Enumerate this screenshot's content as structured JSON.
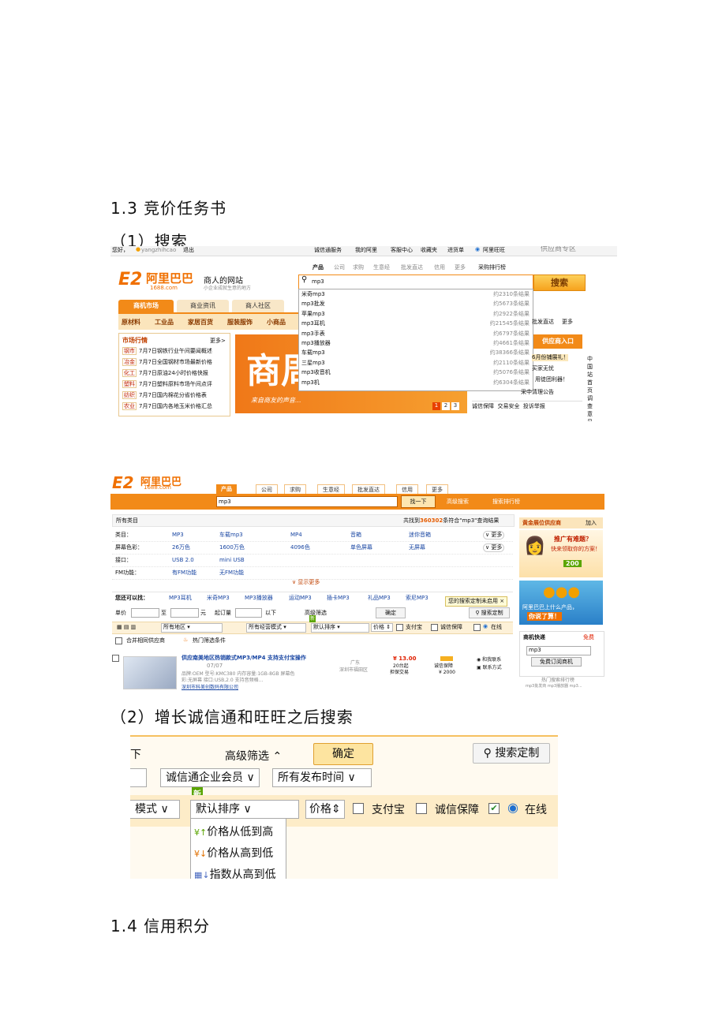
{
  "headings": {
    "h13": "1.3 竞价任务书",
    "search": "（1）搜索",
    "after": "（2）增长诚信通和旺旺之后搜索",
    "h14": "1.4 信用积分"
  },
  "shot1": {
    "topbar_user": "您好，",
    "username": "yangzhihcao",
    "logout": "退出",
    "topbar_links": [
      "诚信通服务",
      "我的阿里",
      "客服中心",
      "收藏夹",
      "进货单",
      "阿里旺旺",
      "供应商专区"
    ],
    "logo_text": "阿里巴巴",
    "logo_domain": "1688.com",
    "slogan": "商人的网站",
    "slogan_sub": "小企业成就生意的地方",
    "search_tabs": [
      "产品",
      "公司",
      "求购",
      "生意经",
      "批发直达",
      "信用",
      "更多",
      "采购排行榜"
    ],
    "search_value": "mp3",
    "search_button": "搜索",
    "suggestions": [
      {
        "t": "米奇mp3",
        "c": "约2310条结果"
      },
      {
        "t": "mp3批发",
        "c": "约5673条结果"
      },
      {
        "t": "苹果mp3",
        "c": "约2922条结果"
      },
      {
        "t": "mp3耳机",
        "c": "约21545条结果"
      },
      {
        "t": "mp3手表",
        "c": "约6797条结果"
      },
      {
        "t": "mp3播放器",
        "c": "约4661条结果"
      },
      {
        "t": "车载mp3",
        "c": "约38366条结果"
      },
      {
        "t": "三星mp3",
        "c": "约2110条结果"
      },
      {
        "t": "mp3收音机",
        "c": "约5076条结果"
      },
      {
        "t": "mp3机",
        "c": "约6304条结果"
      }
    ],
    "nav_tabs": [
      "商机市场",
      "商业资讯",
      "商人社区"
    ],
    "categories": [
      "原材料",
      "工业品",
      "家居百货",
      "服装服饰",
      "小商品"
    ],
    "market_title": "市场行情",
    "market_more": "更多>",
    "market_items": [
      {
        "tag": "钢市",
        "text": "7月7日钢铁行业午间要闻概述"
      },
      {
        "tag": "冶金",
        "text": "7月7日全国钢材市场最新价格"
      },
      {
        "tag": "化工",
        "text": "7月7日原油24小时价格快报"
      },
      {
        "tag": "塑料",
        "text": "7月7日塑料原料市场午间点评"
      },
      {
        "tag": "纺织",
        "text": "7月7日国内棉花分省价格表"
      },
      {
        "tag": "农业",
        "text": "7月7日国内各地玉米价格汇总"
      }
    ],
    "banner_text": "商周",
    "banner_sub": "来自商友的声音...",
    "banner_pages": [
      "1",
      "2",
      "3"
    ],
    "right_links": [
      "批发直达",
      "更多"
    ],
    "supplier_entry": "供应商入口",
    "right_items": [
      "6月份铺展礼！",
      "买家无忧",
      "用徒团利器！",
      "采中清理公告"
    ],
    "right_bottom": [
      "诚信保障",
      "交易安全",
      "投诉举报"
    ],
    "side_vertical": "中国站首页调查意见"
  },
  "shot2": {
    "logo_text": "阿里巴巴",
    "logo_domain": "1688.com",
    "tabs": [
      "产品",
      "公司",
      "求购",
      "生意经",
      "批发直达",
      "信用",
      "更多"
    ],
    "search_value": "mp3",
    "search_button": "找一下",
    "adv_search": "高级搜索",
    "rank": "搜索排行榜",
    "all_categories": "所有类目",
    "result_prefix": "共找到",
    "result_count": "360302",
    "result_suffix": "条符合\"mp3\"查询结果",
    "filter_rows": [
      {
        "label": "类目：",
        "vals": [
          "MP3",
          "车载mp3",
          "MP4",
          "音箱",
          "迷你音箱"
        ]
      },
      {
        "label": "屏幕色彩：",
        "vals": [
          "26万色",
          "1600万色",
          "4096色",
          "单色屏幕",
          "无屏幕"
        ]
      },
      {
        "label": "接口：",
        "vals": [
          "USB 2.0",
          "mini USB"
        ]
      },
      {
        "label": "FM功能：",
        "vals": [
          "有FM功能",
          "无FM功能"
        ]
      }
    ],
    "more_label": "更多",
    "show_more": "显示更多",
    "also_find": "您还可以找：",
    "also_items": [
      "MP3耳机",
      "米奇MP3",
      "MP3播放器",
      "运动MP3",
      "插卡MP3",
      "礼品MP3",
      "索尼MP3"
    ],
    "tip": "您的搜索定制未启用",
    "price_label": "单价",
    "to_label": "至",
    "yuan_label": "元",
    "min_order": "起订量",
    "below": "以下",
    "adv_filter": "高级筛选",
    "confirm": "确定",
    "custom_search": "搜索定制",
    "region": "所有地区",
    "business_mode": "所有经营模式",
    "default_sort": "默认排序",
    "price_sort": "价格",
    "alipay": "支付宝",
    "guarantee": "诚信保障",
    "online": "在线",
    "merge": "合并相同供应商",
    "hot_filter": "热门筛选条件",
    "product_title": "供应南美地区热销款式MP3/MP4 支持支付宝操作",
    "product_date": "07/07",
    "product_desc1": "品牌:OEM 型号:KMC380 内存容量:1GB-8GB 屏幕色",
    "product_desc2": "彩:无屏幕 接口:USB,2.0 支持音频格...",
    "company": "深圳市科美创数码有限公司",
    "location1": "广东",
    "location2": "深圳市福田区",
    "price": "¥ 13.00",
    "qty": "20台起",
    "guarantee_trade": "担保交易",
    "price2": "¥ 2000",
    "contact1": "和我联系",
    "contact2": "联系方式",
    "ad_title": "黄金展位供应商",
    "ad_join": "加入",
    "ad_text1": "推广有难题？",
    "ad_text2": "快来领取你的方案！",
    "ad_price": "200",
    "ad2_line1": "阿里巴巴上什么产品，",
    "ad2_line2": "你说了算！",
    "quick_title": "商机快递",
    "quick_free": "免费",
    "quick_value": "mp3",
    "quick_btn": "免费订阅商机",
    "hot_rank": "热门搜索排行榜",
    "hot_text": "mp3批发商 mp3播放器 mp3..."
  },
  "shot3": {
    "partial_left": "下",
    "adv_filter": "高级筛选",
    "confirm": "确定",
    "custom_search": "搜索定制",
    "member": "诚信通企业会员",
    "time": "所有发布时间",
    "new_badge": "新",
    "mode": "模式",
    "default_sort": "默认排序",
    "price": "价格",
    "alipay": "支付宝",
    "guarantee": "诚信保障",
    "online": "在线",
    "sort_options": [
      "价格从低到高",
      "价格从高到低",
      "指数从高到低"
    ]
  }
}
